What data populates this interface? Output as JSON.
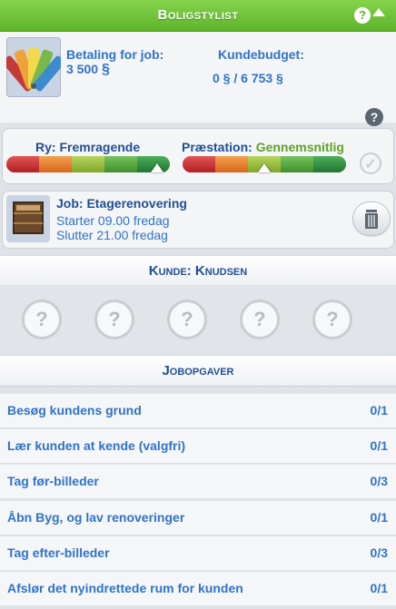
{
  "header": {
    "title": "Boligstylist",
    "help": "?"
  },
  "payment": {
    "label": "Betaling for job:",
    "value": "3 500"
  },
  "budget": {
    "label": "Kundebudget:",
    "value": "0 § / 6 753 §"
  },
  "simoleon_symbol": "§",
  "ratings": {
    "reputation": {
      "label": "Ry:",
      "value": "Fremragende",
      "level": 0.92
    },
    "performance": {
      "label": "Præstation:",
      "value": "Gennemsnitlig",
      "level": 0.5
    }
  },
  "job": {
    "title": "Job: Etagerenovering",
    "start": "Starter 09.00 fredag",
    "end": "Slutter 21.00 fredag"
  },
  "customer": {
    "heading": "Kunde: Knudsen",
    "unknown_traits": [
      "?",
      "?",
      "?",
      "?",
      "?"
    ]
  },
  "tasks": {
    "heading": "Jobopgaver",
    "items": [
      {
        "label": "Besøg kundens grund",
        "count": "0/1"
      },
      {
        "label": "Lær kunden at kende (valgfri)",
        "count": "0/1"
      },
      {
        "label": "Tag før-billeder",
        "count": "0/3"
      },
      {
        "label": "Åbn Byg, og lav renoveringer",
        "count": "0/1"
      },
      {
        "label": "Tag efter-billeder",
        "count": "0/3"
      },
      {
        "label": "Afslør det nyindrettede rum for kunden",
        "count": "0/1"
      }
    ]
  },
  "colors": {
    "header_green": "#6cc13a",
    "text_blue": "#2f73c9",
    "heading_blue": "#1f4f93",
    "perf_green": "#5fa227"
  },
  "icons": [
    "palette-swatch-icon",
    "help-icon",
    "collapse-icon",
    "checkmark-icon",
    "crate-icon",
    "trash-icon",
    "question-trait-icon"
  ]
}
